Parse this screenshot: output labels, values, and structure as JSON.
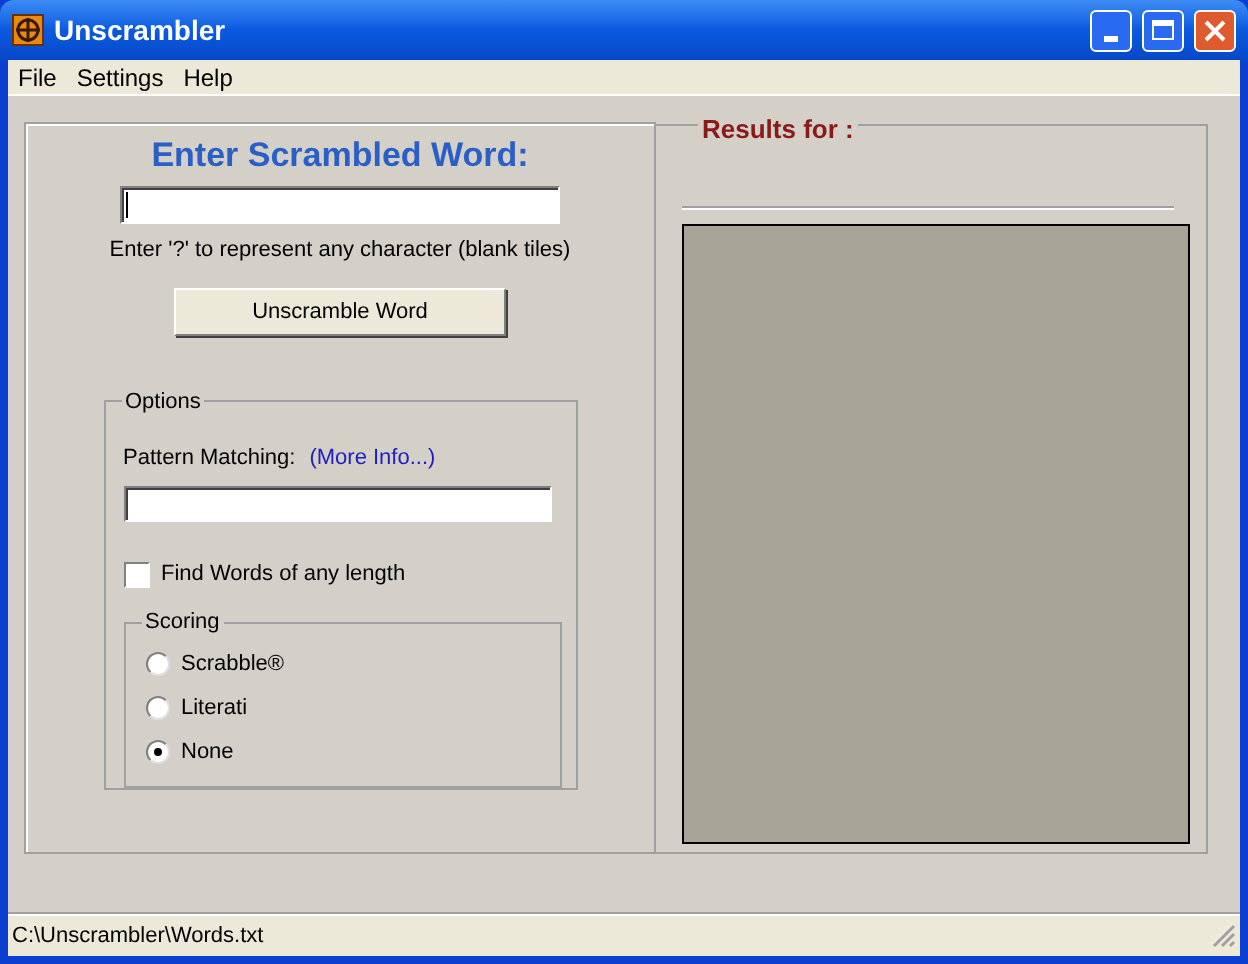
{
  "window": {
    "title": "Unscrambler"
  },
  "menu": [
    "File",
    "Settings",
    "Help"
  ],
  "heading": "Enter Scrambled Word:",
  "hint": "Enter '?' to represent any character (blank tiles)",
  "unscramble_button": "Unscramble Word",
  "options": {
    "title": "Options",
    "pattern_label": "Pattern Matching:",
    "more_info_link": "(More Info...)",
    "any_length": {
      "label": "Find Words of any length",
      "checked": false
    },
    "scoring": {
      "title": "Scoring",
      "choices": [
        {
          "label": "Scrabble®",
          "selected": false
        },
        {
          "label": "Literati",
          "selected": false
        },
        {
          "label": "None",
          "selected": true
        }
      ]
    }
  },
  "results": {
    "title": "Results for :"
  },
  "status_bar": "C:\\Unscrambler\\Words.txt"
}
